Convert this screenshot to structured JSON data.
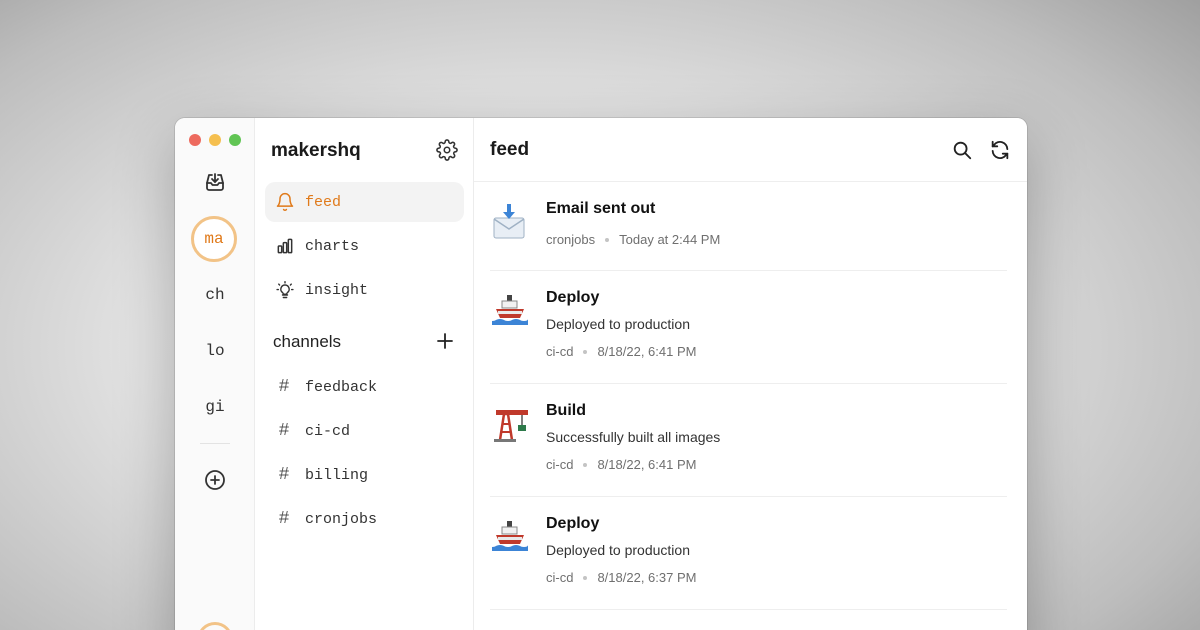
{
  "colors": {
    "accent": "#e07a1a",
    "accent_ring": "#f2c387",
    "traffic_red": "#ed6a5e",
    "traffic_yellow": "#f5bf4f",
    "traffic_green": "#61c554"
  },
  "rail": {
    "workspaces": [
      {
        "label": "ma",
        "active": true
      },
      {
        "label": "ch"
      },
      {
        "label": "lo"
      },
      {
        "label": "gi"
      }
    ],
    "inbox_icon": "inbox-download-icon",
    "add_icon": "circle-plus-icon"
  },
  "sidebar": {
    "workspace_name": "makershq",
    "settings_icon": "gear-icon",
    "nav": [
      {
        "label": "feed",
        "icon": "bell-icon",
        "active": true
      },
      {
        "label": "charts",
        "icon": "bar-chart-icon"
      },
      {
        "label": "insight",
        "icon": "lightbulb-icon"
      }
    ],
    "channels_heading": "channels",
    "channels": [
      "feedback",
      "ci-cd",
      "billing",
      "cronjobs"
    ]
  },
  "main": {
    "title": "feed",
    "search_icon": "search-icon",
    "refresh_icon": "refresh-icon",
    "events": [
      {
        "icon": "incoming-envelope-emoji",
        "title": "Email sent out",
        "description": "",
        "channel": "cronjobs",
        "time": "Today at 2:44 PM"
      },
      {
        "icon": "ship-emoji",
        "title": "Deploy",
        "description": "Deployed to production",
        "channel": "ci-cd",
        "time": "8/18/22, 6:41 PM"
      },
      {
        "icon": "crane-emoji",
        "title": "Build",
        "description": "Successfully built all images",
        "channel": "ci-cd",
        "time": "8/18/22, 6:41 PM"
      },
      {
        "icon": "ship-emoji",
        "title": "Deploy",
        "description": "Deployed to production",
        "channel": "ci-cd",
        "time": "8/18/22, 6:37 PM"
      }
    ]
  }
}
